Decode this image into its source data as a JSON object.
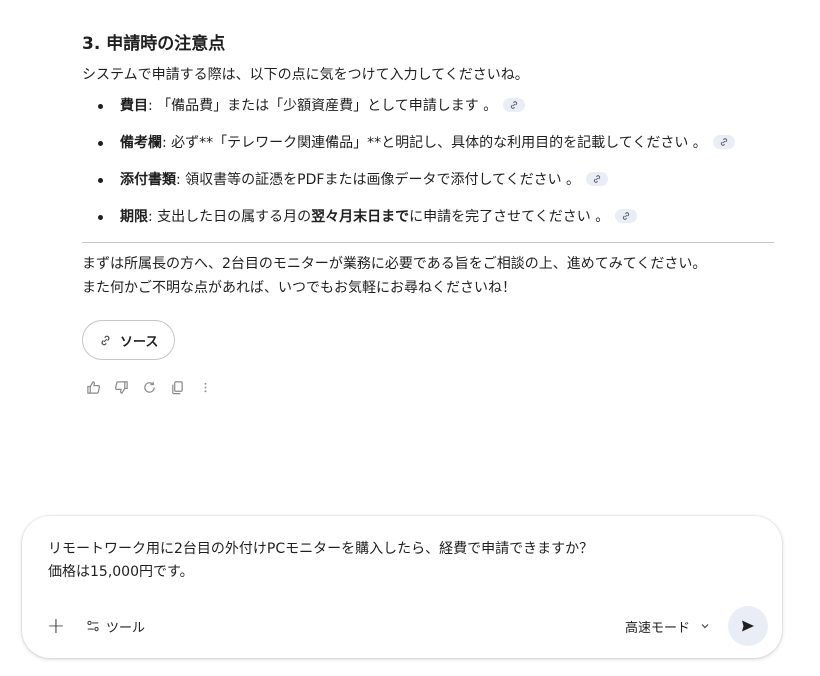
{
  "response": {
    "section_title": "3. 申請時の注意点",
    "intro": "システムで申請する際は、以下の点に気をつけて入力してくださいね。",
    "bullets": [
      {
        "label": "費目",
        "text": ": 「備品費」または「少額資産費」として申請します 。"
      },
      {
        "label": "備考欄",
        "text": ": 必ず**「テレワーク関連備品」**と明記し、具体的な利用目的を記載してください 。"
      },
      {
        "label": "添付書類",
        "text": ": 領収書等の証憑をPDFまたは画像データで添付してください 。"
      },
      {
        "label": "期限",
        "text_before": ": 支出した日の属する月の",
        "text_strong": "翌々月末日まで",
        "text_after": "に申請を完了させてください 。"
      }
    ],
    "closing_line1": "まずは所属長の方へ、2台目のモニターが業務に必要である旨をご相談の上、進めてみてください。",
    "closing_line2": "また何かご不明な点があれば、いつでもお気軽にお尋ねくださいね！",
    "source_button": "ソース"
  },
  "actions": {
    "icons": [
      "thumbs-up-icon",
      "thumbs-down-icon",
      "regenerate-icon",
      "copy-icon",
      "more-icon"
    ]
  },
  "composer": {
    "prompt_text": "リモートワーク用に2台目の外付けPCモニターを購入したら、経費で申請できますか？\n価格は15,000円です。",
    "plus_label": "+",
    "tools_label": "ツール",
    "mode_label": "高速モード"
  },
  "colors": {
    "text": "#1f1f1f",
    "chip_bg": "#e9eef6",
    "icon_gray": "#8a8a8a",
    "divider": "#c7c7c7"
  }
}
